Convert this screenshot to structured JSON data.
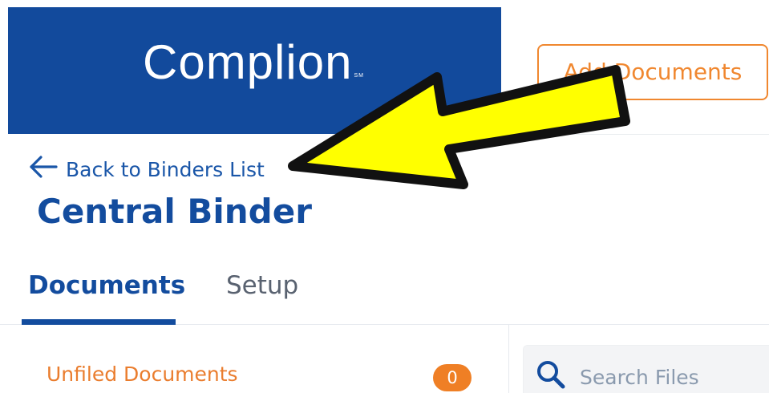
{
  "brand": {
    "logo_text": "Complion",
    "logo_mark": "SM",
    "color": "#124a9c"
  },
  "header": {
    "add_documents_label": "Add Documents",
    "accent_color": "#f0872f"
  },
  "navigation": {
    "back_label": "Back to Binders List",
    "back_icon": "arrow-left-icon"
  },
  "binder": {
    "title": "Central Binder"
  },
  "tabs": [
    {
      "label": "Documents",
      "active": true
    },
    {
      "label": "Setup",
      "active": false
    }
  ],
  "sidebar": {
    "unfiled_label": "Unfiled Documents",
    "unfiled_count": "0",
    "badge_color": "#ef7f25"
  },
  "search": {
    "placeholder": "Search Files",
    "icon": "search-icon"
  },
  "annotation": {
    "icon": "callout-arrow-icon",
    "color": "#ffff00"
  }
}
